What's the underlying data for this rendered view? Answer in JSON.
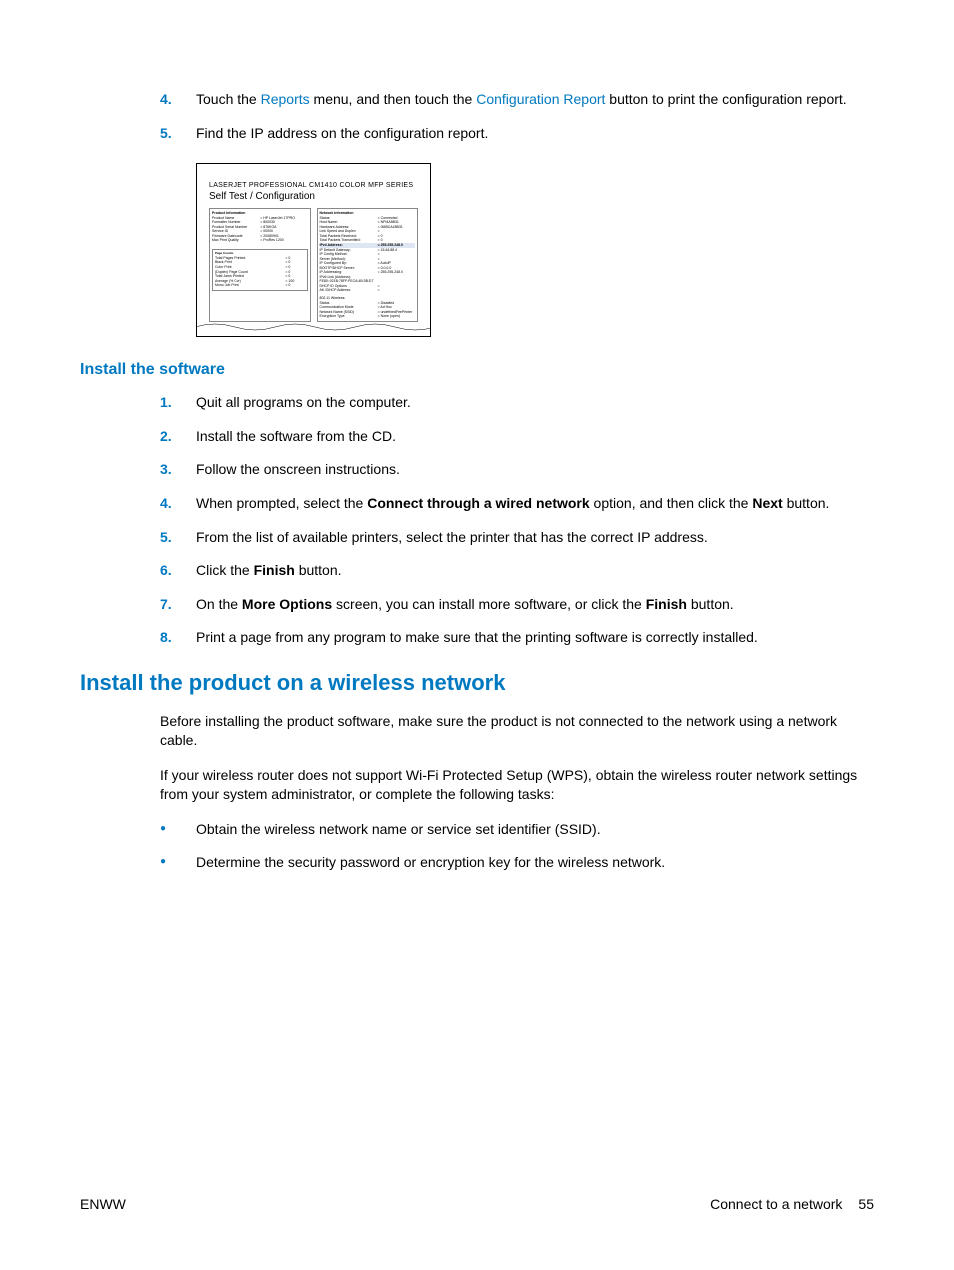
{
  "step4": {
    "num": "4.",
    "pre": "Touch the ",
    "link1": "Reports",
    "mid": " menu, and then touch the ",
    "link2": "Configuration Report",
    "post": " button to print the configuration report."
  },
  "step5": {
    "num": "5.",
    "text": "Find the IP address on the configuration report."
  },
  "figure": {
    "title1": "LASERJET PROFESSIONAL CM1410 COLOR MFP SERIES",
    "title2": "Self Test / Configuration",
    "left_header": "Product Information",
    "right_header": "Network Information",
    "left_rows": [
      [
        "Product Name",
        "= HP LaserJet 17PRO"
      ],
      [
        "Formatter Number",
        "= 800030"
      ],
      [
        "Product Serial Number",
        "= 876KOA"
      ],
      [
        "Service ID",
        "= 00000"
      ],
      [
        "Firmware Datecode",
        "= 20080901"
      ],
      [
        "Max Print Quality",
        "= ProRes 1200"
      ]
    ],
    "left_sub_header": "Page Counts",
    "left_sub_rows": [
      [
        "Total Pages Printed",
        "= 0"
      ],
      [
        "Black Print",
        "= 0"
      ],
      [
        "Color Print",
        "= 0"
      ],
      [
        "(Duplex) Page Count",
        "= 0"
      ],
      [
        "Total Jams Printed",
        "= 0"
      ],
      [
        "Average (% Cvr)",
        "= 100"
      ],
      [
        "Mono Job Print",
        "= 0"
      ]
    ],
    "right_rows": [
      [
        "Status:",
        "= Connected"
      ],
      [
        "Host Name:",
        "= NPI4A5B31"
      ],
      [
        "Hardware Address:",
        "= 0MBCA45B31"
      ],
      [
        "Link Speed and Duplex",
        "= "
      ],
      [
        "Total Packets Received:",
        "= 0"
      ],
      [
        "Total Packets Transmitted:",
        "= 0"
      ]
    ],
    "ipv4_header": "IPv4 Address:",
    "ipv4_value": "= 255.255.248.0",
    "right_rows2": [
      [
        "IP Default Gateway:",
        "= 15.64.88.4"
      ],
      [
        "IP Config Method:",
        "= "
      ],
      [
        "Server (Method):",
        "= "
      ],
      [
        "IP Configured By:",
        "= AutoIP"
      ],
      [
        "BOOTP/DHCP Server:",
        "= 0.0.0.0"
      ],
      [
        "IP Addressing:",
        "= 255.255.248.0"
      ],
      [
        "IPv6 Link (Address):",
        ""
      ],
      [
        "FE80::021B:78FF:FECA:4B:3B:D7",
        ""
      ],
      [
        "DHCP ID Options",
        "= "
      ],
      [
        "Alt. IDHCP Address:",
        "= "
      ]
    ],
    "right_rows3": [
      [
        "802.11 Wireless:",
        ""
      ],
      [
        "Status",
        "= Disabled"
      ],
      [
        "Communication Mode",
        "= Ad Hoc"
      ],
      [
        "Network Name (SSID)",
        "= undefinedFeePrinter"
      ],
      [
        "Encryption Type",
        "= None (open)"
      ]
    ]
  },
  "h3_install_sw": "Install the software",
  "sw_steps": {
    "s1": {
      "num": "1.",
      "text": "Quit all programs on the computer."
    },
    "s2": {
      "num": "2.",
      "text": "Install the software from the CD."
    },
    "s3": {
      "num": "3.",
      "text": "Follow the onscreen instructions."
    },
    "s4": {
      "num": "4.",
      "pre": "When prompted, select the ",
      "b1": "Connect through a wired network",
      "mid": " option, and then click the ",
      "b2": "Next",
      "post": " button."
    },
    "s5": {
      "num": "5.",
      "text": "From the list of available printers, select the printer that has the correct IP address."
    },
    "s6": {
      "num": "6.",
      "pre": "Click the ",
      "b1": "Finish",
      "post": " button."
    },
    "s7": {
      "num": "7.",
      "pre": "On the ",
      "b1": "More Options",
      "mid": " screen, you can install more software, or click the ",
      "b2": "Finish",
      "post": " button."
    },
    "s8": {
      "num": "8.",
      "text": "Print a page from any program to make sure that the printing software is correctly installed."
    }
  },
  "h2_wireless": "Install the product on a wireless network",
  "wireless_para1": "Before installing the product software, make sure the product is not connected to the network using a network cable.",
  "wireless_para2": "If your wireless router does not support Wi-Fi Protected Setup (WPS), obtain the wireless router network settings from your system administrator, or complete the following tasks:",
  "bullets": {
    "b1": "Obtain the wireless network name or service set identifier (SSID).",
    "b2": "Determine the security password or encryption key for the wireless network."
  },
  "footer": {
    "left": "ENWW",
    "right_text": "Connect to a network",
    "page": "55"
  }
}
